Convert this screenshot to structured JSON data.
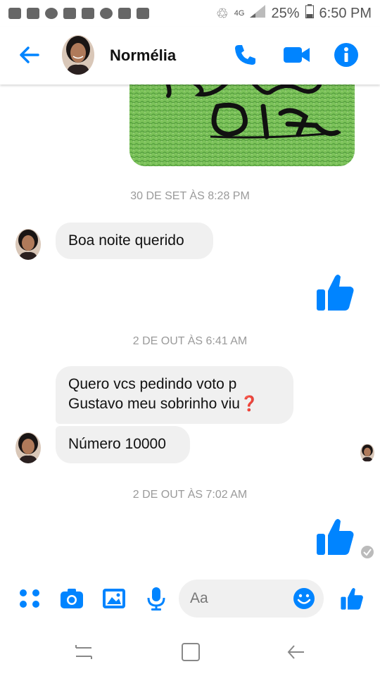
{
  "status_bar": {
    "network_label": "4G",
    "battery": "25%",
    "time": "6:50 PM"
  },
  "header": {
    "contact_name": "Normélia"
  },
  "messages": {
    "timestamp_1": "30 DE SET ÀS 8:28 PM",
    "msg_1": "Boa noite querido",
    "timestamp_2": "2 DE OUT ÀS 6:41 AM",
    "msg_2_line1": "Quero vcs pedindo voto p",
    "msg_2_line2": "Gustavo meu sobrinho viu❓",
    "msg_3": "Número 10000",
    "timestamp_3": "2 DE OUT ÀS 7:02 AM"
  },
  "composer": {
    "placeholder": "Aa"
  },
  "colors": {
    "accent": "#0084ff",
    "bubble": "#f0f0f0",
    "timestamp": "#9a9a9a"
  }
}
